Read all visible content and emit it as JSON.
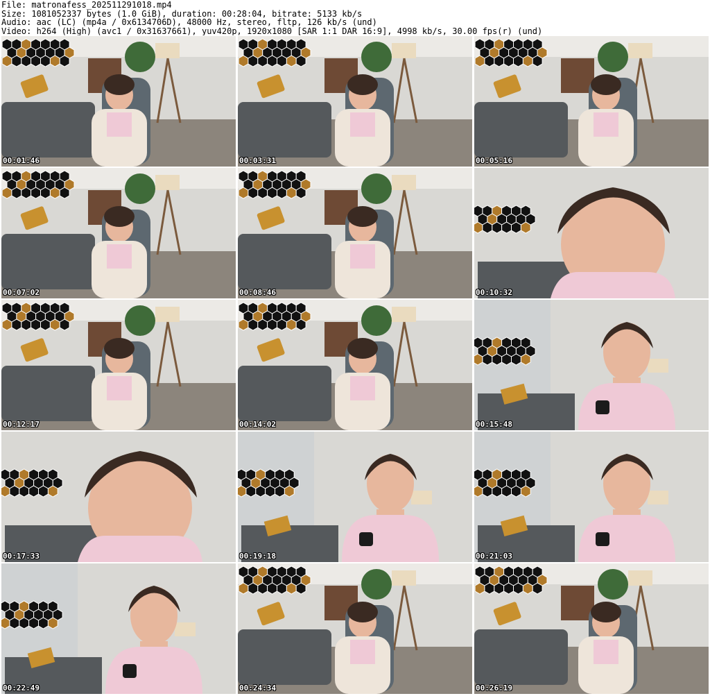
{
  "header": {
    "line1": "File: matronafess_202511291018.mp4",
    "line2": "Size: 1081052337 bytes (1.0 GiB), duration: 00:28:04, bitrate: 5133 kb/s",
    "line3": "Audio: aac (LC) (mp4a / 0x6134706D), 48000 Hz, stereo, fltp, 126 kb/s (und)",
    "line4": "Video: h264 (High) (avc1 / 0x31637661), yuv420p, 1920x1080 [SAR 1:1 DAR 16:9], 4998 kb/s, 30.00 fps(r) (und)"
  },
  "thumbnails": [
    {
      "time": "00:01:46",
      "scene": "room"
    },
    {
      "time": "00:03:31",
      "scene": "room"
    },
    {
      "time": "00:05:16",
      "scene": "room"
    },
    {
      "time": "00:07:02",
      "scene": "room"
    },
    {
      "time": "00:08:46",
      "scene": "room"
    },
    {
      "time": "00:10:32",
      "scene": "close"
    },
    {
      "time": "00:12:17",
      "scene": "room"
    },
    {
      "time": "00:14:02",
      "scene": "room"
    },
    {
      "time": "00:15:48",
      "scene": "near"
    },
    {
      "time": "00:17:33",
      "scene": "close"
    },
    {
      "time": "00:19:18",
      "scene": "near"
    },
    {
      "time": "00:21:03",
      "scene": "near"
    },
    {
      "time": "00:22:49",
      "scene": "near"
    },
    {
      "time": "00:24:34",
      "scene": "room"
    },
    {
      "time": "00:26:19",
      "scene": "room"
    }
  ],
  "colors": {
    "wall": "#d9d8d4",
    "floor": "#8c857c",
    "sofa": "#55595c",
    "pillow": "#c8912f",
    "hex": "#111111",
    "skin": "#e7b79d",
    "top": "#efc9d6",
    "hair": "#3a2a22"
  }
}
